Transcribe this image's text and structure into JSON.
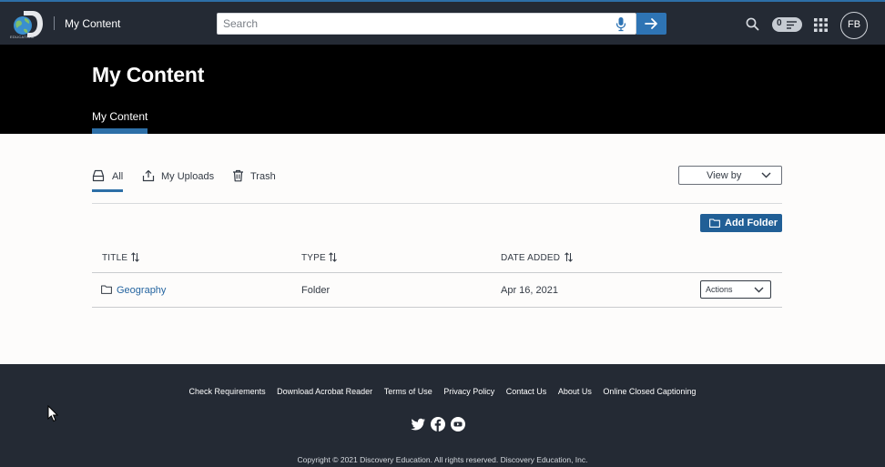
{
  "header": {
    "logo_text": "EDUCATION",
    "app_title": "My Content",
    "search": {
      "placeholder": "Search",
      "value": ""
    },
    "counter_value": "0",
    "avatar_initials": "FB"
  },
  "hero": {
    "title": "My Content",
    "tabs": [
      {
        "label": "My Content",
        "active": true
      }
    ]
  },
  "filters": {
    "tabs": [
      {
        "label": "All",
        "active": true,
        "icon": "tray-icon"
      },
      {
        "label": "My Uploads",
        "active": false,
        "icon": "upload-icon"
      },
      {
        "label": "Trash",
        "active": false,
        "icon": "trash-icon"
      }
    ],
    "view_by_label": "View by"
  },
  "add_folder_label": "Add Folder",
  "table": {
    "columns": [
      "TITLE",
      "TYPE",
      "DATE ADDED"
    ],
    "rows": [
      {
        "title": "Geography",
        "type": "Folder",
        "date_added": "Apr 16, 2021",
        "action_label": "Actions"
      }
    ]
  },
  "footer": {
    "links": [
      "Check Requirements",
      "Download Acrobat Reader",
      "Terms of Use",
      "Privacy Policy",
      "Contact Us",
      "About Us",
      "Online Closed Captioning"
    ],
    "social": [
      "twitter-icon",
      "facebook-icon",
      "youtube-icon"
    ],
    "copyright": "Copyright © 2021 Discovery Education. All rights reserved. Discovery Education, Inc."
  },
  "colors": {
    "topbar": "#242a34",
    "accent": "#2d6fa7",
    "button": "#215f96",
    "link": "#2565a0"
  }
}
